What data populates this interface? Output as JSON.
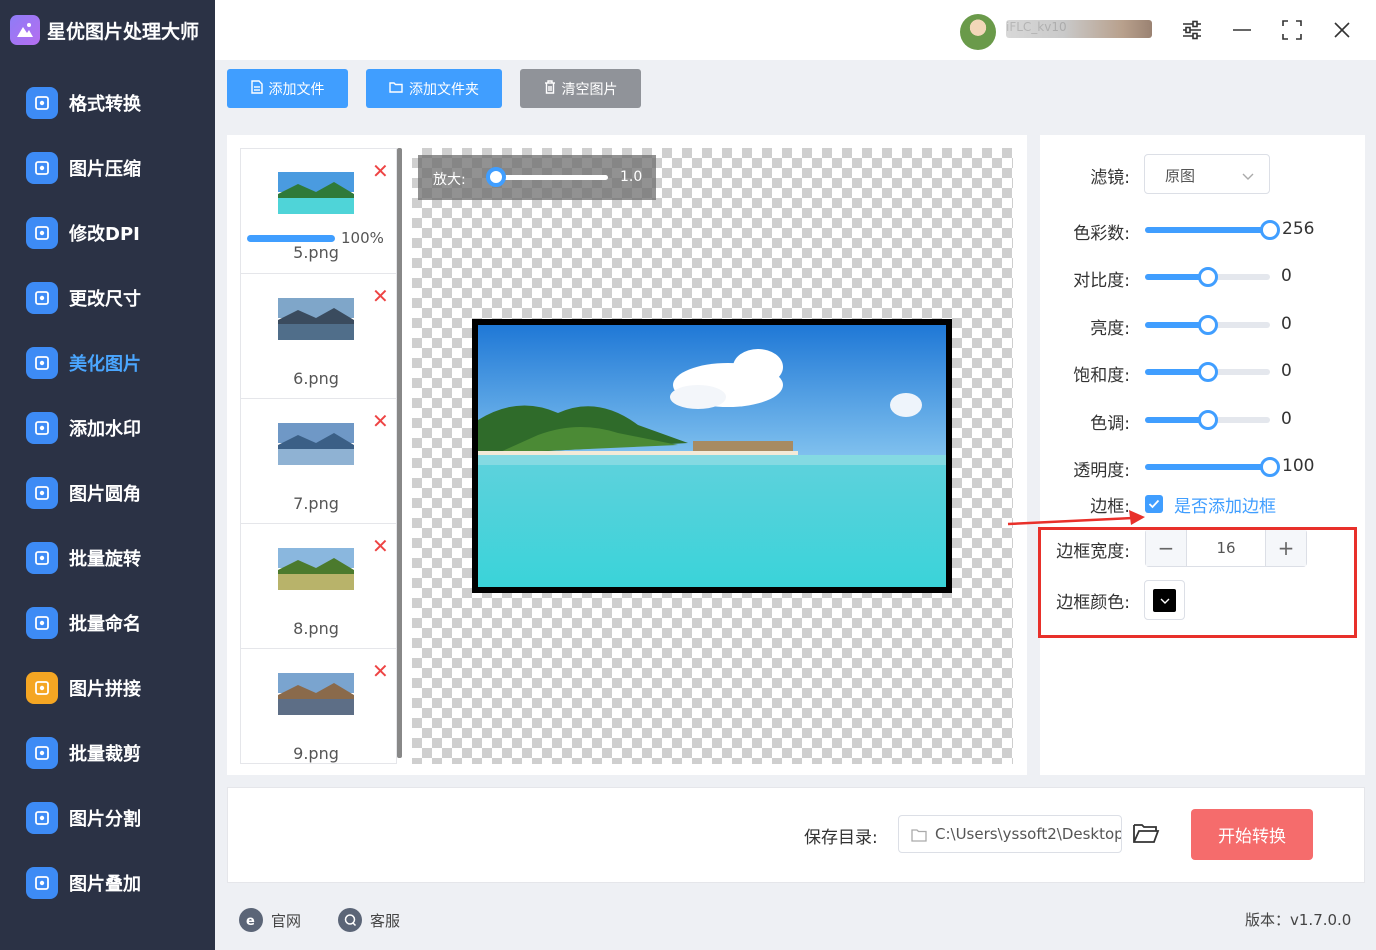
{
  "app": {
    "title": "星优图片处理大师",
    "user": "iFLC_kv10"
  },
  "sidebar": {
    "items": [
      {
        "label": "格式转换",
        "icon": "image-convert-icon",
        "color": "#3d8bf5"
      },
      {
        "label": "图片压缩",
        "icon": "compress-icon",
        "color": "#3d8bf5"
      },
      {
        "label": "修改DPI",
        "icon": "dpi-icon",
        "color": "#3d8bf5"
      },
      {
        "label": "更改尺寸",
        "icon": "resize-icon",
        "color": "#3d8bf5"
      },
      {
        "label": "美化图片",
        "icon": "beautify-icon",
        "color": "#3d8bf5",
        "active": true
      },
      {
        "label": "添加水印",
        "icon": "watermark-icon",
        "color": "#3d8bf5"
      },
      {
        "label": "图片圆角",
        "icon": "round-corner-icon",
        "color": "#3d8bf5"
      },
      {
        "label": "批量旋转",
        "icon": "rotate-icon",
        "color": "#3d8bf5"
      },
      {
        "label": "批量命名",
        "icon": "rename-icon",
        "color": "#3d8bf5"
      },
      {
        "label": "图片拼接",
        "icon": "puzzle-icon",
        "color": "#f5a623"
      },
      {
        "label": "批量裁剪",
        "icon": "crop-icon",
        "color": "#3d8bf5"
      },
      {
        "label": "图片分割",
        "icon": "split-icon",
        "color": "#3d8bf5"
      },
      {
        "label": "图片叠加",
        "icon": "layers-icon",
        "color": "#3d8bf5"
      }
    ]
  },
  "toolbar": {
    "add_file": "添加文件",
    "add_folder": "添加文件夹",
    "clear": "清空图片"
  },
  "files": [
    {
      "name": "5.png",
      "progress": "100%",
      "progress_value": 1.0
    },
    {
      "name": "6.png"
    },
    {
      "name": "7.png"
    },
    {
      "name": "8.png"
    },
    {
      "name": "9.png"
    }
  ],
  "preview": {
    "zoom_label": "放大:",
    "zoom_value": "1.0",
    "zoom_fraction": 0.08
  },
  "settings": {
    "filter_label": "滤镜:",
    "filter_value": "原图",
    "sliders": [
      {
        "label": "色彩数:",
        "value": "256",
        "fraction": 1.0
      },
      {
        "label": "对比度:",
        "value": "0",
        "fraction": 0.5
      },
      {
        "label": "亮度:",
        "value": "0",
        "fraction": 0.5
      },
      {
        "label": "饱和度:",
        "value": "0",
        "fraction": 0.5
      },
      {
        "label": "色调:",
        "value": "0",
        "fraction": 0.5
      },
      {
        "label": "透明度:",
        "value": "100",
        "fraction": 1.0
      }
    ],
    "border_label": "边框:",
    "border_checkbox_label": "是否添加边框",
    "border_checked": true,
    "border_width_label": "边框宽度:",
    "border_width_value": "16",
    "border_color_label": "边框颜色:",
    "border_color": "#000000"
  },
  "bottom": {
    "save_label": "保存目录:",
    "save_path": "C:\\Users\\yssoft2\\Desktop",
    "start_button": "开始转换"
  },
  "footer": {
    "website": "官网",
    "support": "客服",
    "version": "版本：v1.7.0.0"
  },
  "colors": {
    "accent": "#409eff",
    "sidebar_bg": "#2b3245",
    "start_button": "#f56c6c",
    "highlight_box": "#e8302a"
  }
}
